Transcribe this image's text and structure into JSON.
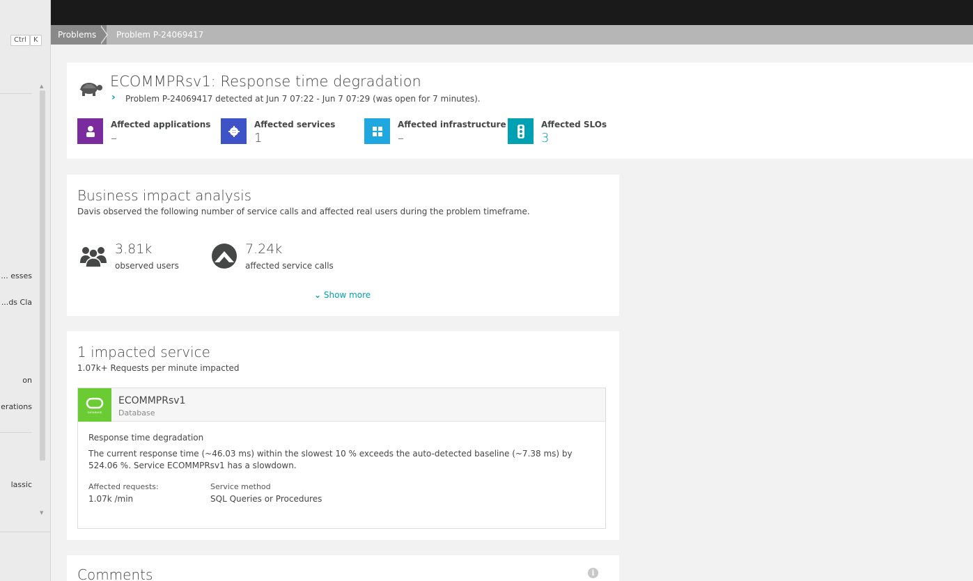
{
  "sidebar": {
    "shortcut_ctrl": "Ctrl",
    "shortcut_k": "K",
    "items": [
      {
        "label": "esses ..."
      },
      {
        "label": "ds Cla..."
      },
      {
        "label": "on"
      },
      {
        "label": "erations"
      },
      {
        "label": "lassic"
      }
    ]
  },
  "breadcrumb": {
    "items": [
      "Problems",
      "Problem P-24069417"
    ]
  },
  "problem": {
    "title": "ECOMMPRsv1: Response time degradation",
    "subtitle": "Problem P-24069417 detected at Jun 7 07:22 - Jun 7 07:29 (was open for 7 minutes).",
    "affected": [
      {
        "label": "Affected applications",
        "value": "–",
        "color": "#7a2c9e",
        "icon": "user-app-icon"
      },
      {
        "label": "Affected services",
        "value": "1",
        "color": "#3e53c8",
        "icon": "gear-icon"
      },
      {
        "label": "Affected infrastructure",
        "value": "–",
        "color": "#1fa8e0",
        "icon": "infrastructure-icon"
      },
      {
        "label": "Affected SLOs",
        "value": "3",
        "color": "#00a1b2",
        "icon": "traffic-light-icon"
      }
    ]
  },
  "business_impact": {
    "title": "Business impact analysis",
    "subtitle": "Davis observed the following number of service calls and affected real users during the problem timeframe.",
    "users_value": "3.81k",
    "users_label": "observed users",
    "calls_value": "7.24k",
    "calls_label": "affected service calls",
    "show_more": "Show more"
  },
  "impacted": {
    "title": "1 impacted service",
    "subtitle": "1.07k+ Requests per minute impacted",
    "service": {
      "name": "ECOMMPRsv1",
      "type": "Database",
      "db_badge": "DATABASE",
      "event_title": "Response time degradation",
      "description": "The current response time (~46.03 ms) within the slowest 10 % exceeds the auto-detected baseline (~7.38 ms) by 524.06 %. Service ECOMMPRsv1 has a slowdown.",
      "affected_requests_label": "Affected requests:",
      "affected_requests_value": "1.07k /min",
      "service_method_label": "Service method",
      "service_method_value": "SQL Queries or Procedures"
    }
  },
  "comments": {
    "title": "Comments",
    "info": "i"
  },
  "colors": {
    "accent": "#00a1b2",
    "database": "#6bcb33"
  }
}
